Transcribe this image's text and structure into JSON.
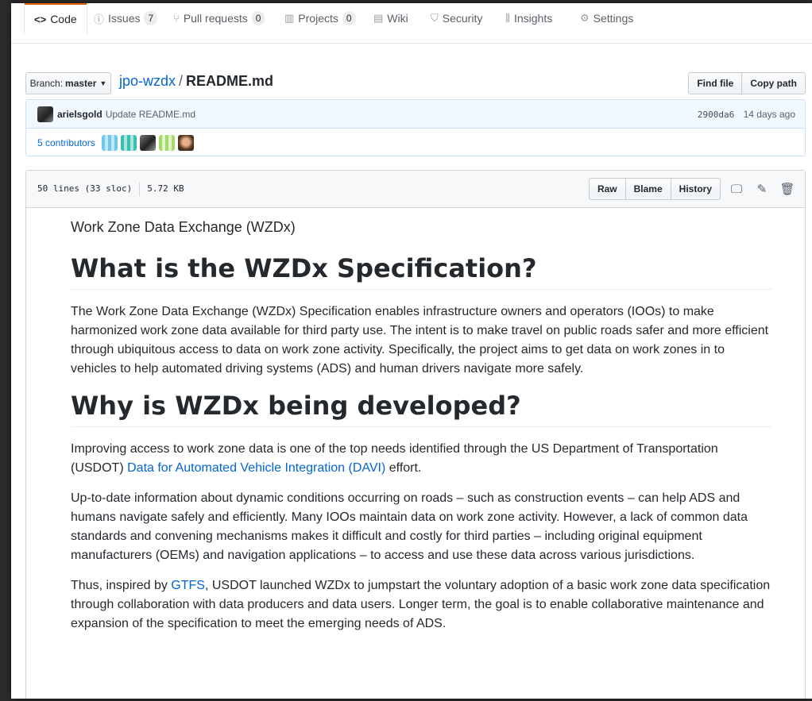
{
  "tabs": [
    {
      "label": "Code",
      "icon": "code-icon",
      "glyph": "<>",
      "counter": null
    },
    {
      "label": "Issues",
      "icon": "issue-opened-icon",
      "glyph": "ⓘ",
      "counter": "7"
    },
    {
      "label": "Pull requests",
      "icon": "git-pull-request-icon",
      "glyph": "⑂",
      "counter": "0"
    },
    {
      "label": "Projects",
      "icon": "project-icon",
      "glyph": "▥",
      "counter": "0"
    },
    {
      "label": "Wiki",
      "icon": "book-icon",
      "glyph": "▤",
      "counter": null
    },
    {
      "label": "Security",
      "icon": "shield-icon",
      "glyph": "⛉",
      "counter": null
    },
    {
      "label": "Insights",
      "icon": "graph-icon",
      "glyph": "⫼",
      "counter": null
    },
    {
      "label": "Settings",
      "icon": "gear-icon",
      "glyph": "⚙",
      "counter": null
    }
  ],
  "branch": {
    "prefix": "Branch:",
    "name": "master"
  },
  "breadcrumb": {
    "repo": "jpo-wzdx",
    "separator": "/",
    "file": "README.md"
  },
  "file_nav": {
    "find_file": "Find file",
    "copy_path": "Copy path"
  },
  "commit": {
    "author": "arielsgold",
    "message": "Update README.md",
    "sha": "2900da6",
    "time": "14 days ago",
    "contributors": "5 contributors"
  },
  "file": {
    "lines": "50 lines (33 sloc)",
    "size": "5.72 KB",
    "raw": "Raw",
    "blame": "Blame",
    "history": "History"
  },
  "readme": {
    "title_line": "Work Zone Data Exchange (WZDx)",
    "h1_what": "What is the WZDx Specification?",
    "p_what": "The Work Zone Data Exchange (WZDx) Specification enables infrastructure owners and operators (IOOs) to make harmonized work zone data available for third party use. The intent is to make travel on public roads safer and more efficient through ubiquitous access to data on work zone activity. Specifically, the project aims to get data on work zones in to vehicles to help automated driving systems (ADS) and human drivers navigate more safely.",
    "h1_why": "Why is WZDx being developed?",
    "p_why_1_a": "Improving access to work zone data is one of the top needs identified through the US Department of Transportation (USDOT) ",
    "p_why_1_link": "Data for Automated Vehicle Integration (DAVI)",
    "p_why_1_b": " effort.",
    "p_why_2": "Up-to-date information about dynamic conditions occurring on roads – such as construction events – can help ADS and humans navigate safely and efficiently. Many IOOs maintain data on work zone activity. However, a lack of common data standards and convening mechanisms makes it difficult and costly for third parties – including original equipment manufacturers (OEMs) and navigation applications – to access and use these data across various jurisdictions.",
    "p_why_3_a": "Thus, inspired by ",
    "p_why_3_link": "GTFS",
    "p_why_3_b": ", USDOT launched WZDx to jumpstart the voluntary adoption of a basic work zone data specification through collaboration with data producers and data users. Longer term, the goal is to enable collaborative maintenance and expansion of the specification to meet the emerging needs of ADS."
  }
}
